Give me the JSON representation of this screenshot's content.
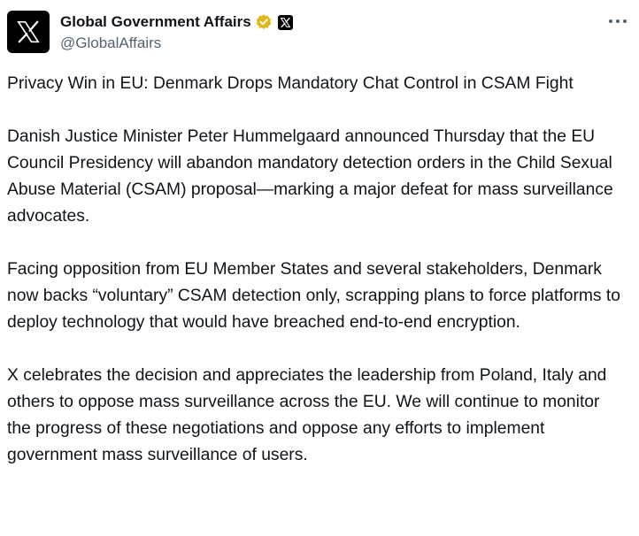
{
  "account": {
    "display_name": "Global Government Affairs",
    "handle": "@GlobalAffairs",
    "verified_badge_color": "#e2b719",
    "avatar_icon": "x-logo-icon",
    "affiliate_icon": "x-logo-icon"
  },
  "post": {
    "title": "Privacy Win in EU: Denmark Drops Mandatory Chat Control in CSAM Fight",
    "paragraph_1": "Danish Justice Minister Peter Hummelgaard announced Thursday that the EU Council Presidency will abandon mandatory detection orders in the Child Sexual Abuse Material (CSAM) proposal—marking a major defeat for mass surveillance advocates.",
    "paragraph_2": "Facing opposition from EU Member States and several stakeholders, Denmark now backs “voluntary” CSAM detection only, scrapping plans to force platforms to deploy technology that would have breached end-to-end encryption.",
    "paragraph_3": "X celebrates the decision and appreciates the leadership from Poland, Italy and others to oppose mass surveillance across the EU. We will continue to monitor the progress of these negotiations and oppose any efforts to implement government mass surveillance of users."
  },
  "colors": {
    "text": "#0f1419",
    "secondary_text": "#536471",
    "brand": "#000000"
  }
}
